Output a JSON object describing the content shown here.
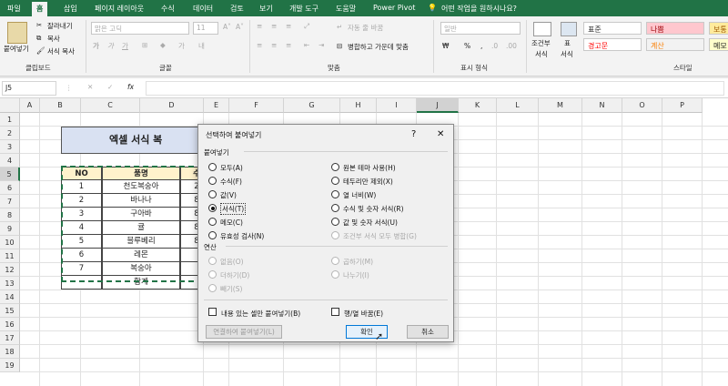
{
  "tabs": [
    "파일",
    "홈",
    "삽입",
    "페이지 레이아웃",
    "수식",
    "데이터",
    "검토",
    "보기",
    "개발 도구",
    "도움말",
    "Power Pivot",
    "어떤 작업을 원하시나요?"
  ],
  "ribbon": {
    "clipboard": {
      "paste": "붙여넣기",
      "cut": "잘라내기",
      "copy": "복사",
      "format_painter": "서식 복사",
      "group": "클립보드"
    },
    "font": {
      "name": "맑은 고딕",
      "size": "11",
      "group": "글꼴"
    },
    "align": {
      "wrap": "자동 줄 바꿈",
      "merge": "병합하고 가운데 맞춤",
      "group": "맞춤"
    },
    "number": {
      "format": "일반",
      "group": "표시 형식"
    },
    "styles": {
      "conditional": "조건부",
      "conditional2": "서식",
      "table": "표",
      "table2": "서식",
      "normal": "표준",
      "bad": "나쁨",
      "good": "보통",
      "neutral": "경고문",
      "calc": "계산",
      "check": "메모",
      "group": "스타일"
    }
  },
  "formula_bar": {
    "name_box": "J5",
    "fx": "fx",
    "cancel": "✕",
    "enter": "✓",
    "value": ""
  },
  "columns": [
    "A",
    "B",
    "C",
    "D",
    "E",
    "F",
    "G",
    "H",
    "I",
    "J",
    "K",
    "L",
    "M",
    "N",
    "O",
    "P"
  ],
  "rows": [
    "1",
    "2",
    "3",
    "4",
    "5",
    "6",
    "7",
    "8",
    "9",
    "10",
    "11",
    "12",
    "13",
    "14",
    "15",
    "16",
    "17",
    "18",
    "19"
  ],
  "sheet": {
    "title": "엑셀 서식 복",
    "headers": [
      "NO",
      "품명",
      "수"
    ],
    "rows": [
      [
        "1",
        "천도복숭아",
        "2"
      ],
      [
        "2",
        "바나나",
        "8"
      ],
      [
        "3",
        "구아바",
        "8"
      ],
      [
        "4",
        "귤",
        "8"
      ],
      [
        "5",
        "블루베리",
        "8"
      ],
      [
        "6",
        "레몬",
        ""
      ],
      [
        "7",
        "복숭아",
        ""
      ],
      [
        "",
        "합계",
        ""
      ]
    ]
  },
  "dialog": {
    "title": "선택하여 붙여넣기",
    "help": "?",
    "close": "✕",
    "paste_label": "붙여넣기",
    "paste_left": [
      "모두(A)",
      "수식(F)",
      "값(V)",
      "서식(T)",
      "메모(C)",
      "유효성 검사(N)"
    ],
    "paste_right": [
      "원본 테마 사용(H)",
      "테두리만 제외(X)",
      "열 너비(W)",
      "수식 및 숫자 서식(R)",
      "값 및 숫자 서식(U)",
      "조건부 서식 모두 병합(G)"
    ],
    "selected": "서식(T)",
    "op_label": "연산",
    "op_left": [
      "없음(O)",
      "더하기(D)",
      "빼기(S)"
    ],
    "op_right": [
      "곱하기(M)",
      "나누기(I)"
    ],
    "skip_blanks": "내용 있는 셀만 붙여넣기(B)",
    "transpose": "행/열 바꿈(E)",
    "paste_link": "연결하여 붙여넣기(L)",
    "ok": "확인",
    "cancel": "취소"
  },
  "colors": {
    "excel_green": "#217346",
    "title_fill": "#d9e1f2",
    "header_fill": "#fff2cc",
    "marching_ants": "#217346"
  }
}
